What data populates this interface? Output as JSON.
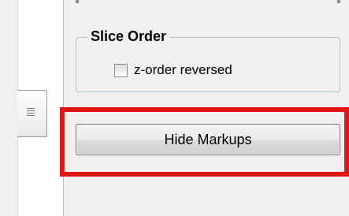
{
  "slice_order_group": {
    "title": "Slice Order",
    "checkbox_label": "z-order reversed",
    "checkbox_checked": false
  },
  "side_tab": {
    "icon": "hamburger-lines-icon"
  },
  "hide_markups_button": {
    "label": "Hide Markups"
  },
  "colors": {
    "panel_background": "#f0f0f0",
    "highlight_border": "#e01616",
    "group_border": "#b9c3cf"
  }
}
